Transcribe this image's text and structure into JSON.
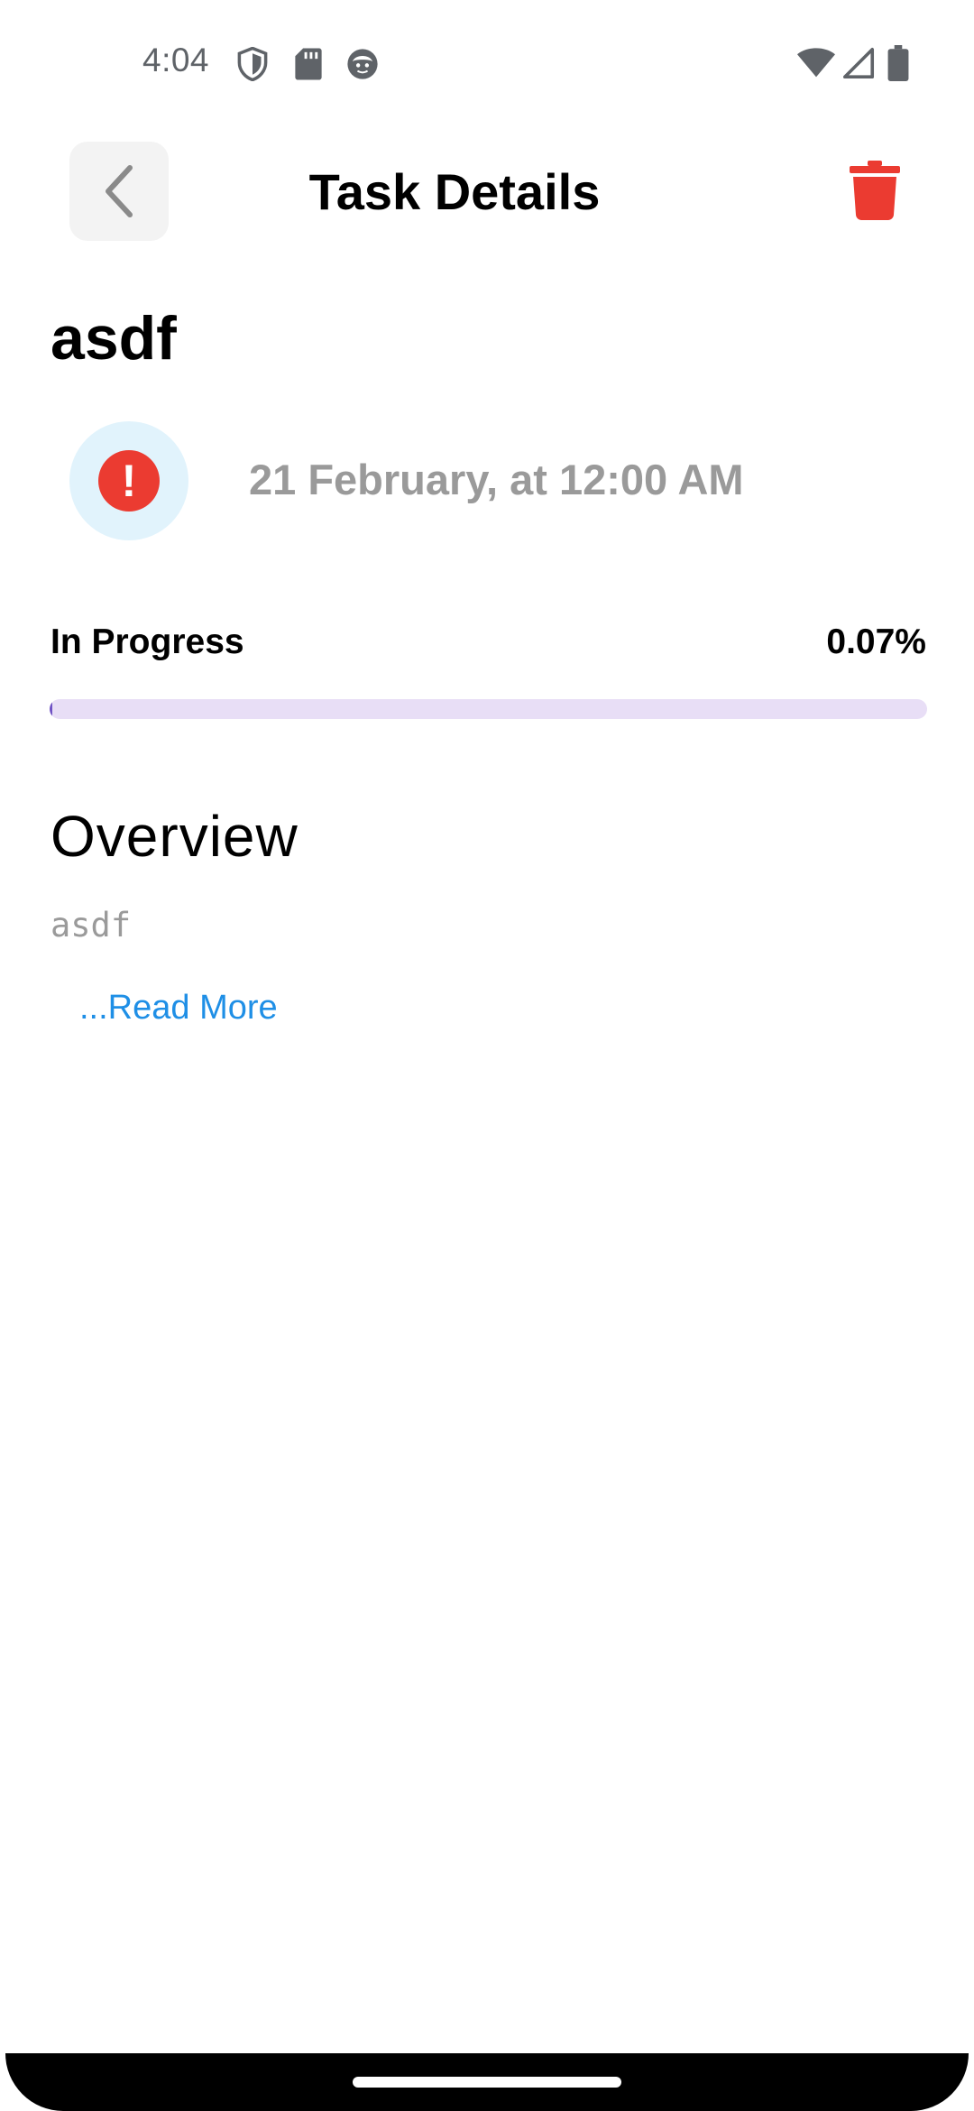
{
  "status_bar": {
    "time": "4:04",
    "left_icons": [
      "shield-icon",
      "sd-card-icon",
      "face-icon"
    ],
    "right_icons": [
      "wifi-icon",
      "cell-signal-icon",
      "battery-icon"
    ]
  },
  "app_bar": {
    "title": "Task Details",
    "back_icon": "chevron-left-icon",
    "delete_icon": "trash-icon"
  },
  "task": {
    "title": "asdf",
    "due_date": "21 February, at 12:00 AM",
    "priority_icon": "exclamation-icon",
    "progress_label": "In Progress",
    "progress_text": "0.07%",
    "progress_fraction": 0.0007,
    "overview_heading": "Overview",
    "overview_body": "asdf",
    "read_more": "...Read More"
  },
  "colors": {
    "delete": "#eb3b31",
    "priority_bg": "#e1f3fc",
    "progress_track": "#e8def6",
    "link": "#1f8fe6",
    "muted_text": "#9a9a9a"
  }
}
